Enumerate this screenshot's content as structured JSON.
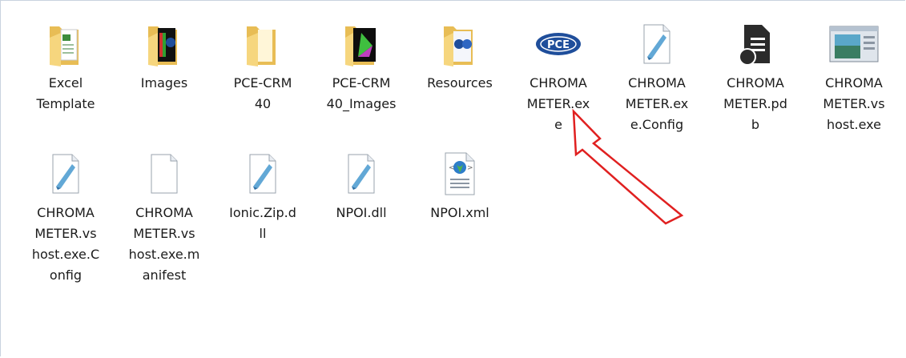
{
  "files": [
    {
      "name": "Excel Template",
      "lines": [
        "Excel",
        "Template"
      ],
      "icon": "folder-excel-icon",
      "interactable": true
    },
    {
      "name": "Images",
      "lines": [
        "Images"
      ],
      "icon": "folder-images-icon",
      "interactable": true
    },
    {
      "name": "PCE-CRM 40",
      "lines": [
        "PCE-CRM",
        "40"
      ],
      "icon": "folder-icon",
      "interactable": true
    },
    {
      "name": "PCE-CRM 40_Images",
      "lines": [
        "PCE-CRM",
        "40_Images"
      ],
      "icon": "folder-chromaticity-icon",
      "interactable": true
    },
    {
      "name": "Resources",
      "lines": [
        "Resources"
      ],
      "icon": "folder-resources-icon",
      "interactable": true
    },
    {
      "name": "CHROMA METER.exe",
      "lines": [
        "CHROMA",
        "METER.ex",
        "e"
      ],
      "icon": "pce-logo-icon",
      "interactable": true
    },
    {
      "name": "CHROMA METER.exe.Config",
      "lines": [
        "CHROMA",
        "METER.ex",
        "e.Config"
      ],
      "icon": "config-file-icon",
      "interactable": true
    },
    {
      "name": "CHROMA METER.pdb",
      "lines": [
        "CHROMA",
        "METER.pd",
        "b"
      ],
      "icon": "pdb-file-icon",
      "interactable": true
    },
    {
      "name": "CHROMA METER.vshost.exe",
      "lines": [
        "CHROMA",
        "METER.vs",
        "host.exe"
      ],
      "icon": "window-app-icon",
      "interactable": true
    },
    {
      "name": "CHROMA METER.vshost.exe.Config",
      "lines": [
        "CHROMA",
        "METER.vs",
        "host.exe.C",
        "onfig"
      ],
      "icon": "config-file-icon",
      "interactable": true
    },
    {
      "name": "CHROMA METER.vshost.exe.manifest",
      "lines": [
        "CHROMA",
        "METER.vs",
        "host.exe.m",
        "anifest"
      ],
      "icon": "blank-file-icon",
      "interactable": true
    },
    {
      "name": "Ionic.Zip.dll",
      "lines": [
        "Ionic.Zip.d",
        "ll"
      ],
      "icon": "config-file-icon",
      "interactable": true
    },
    {
      "name": "NPOI.dll",
      "lines": [
        "NPOI.dll"
      ],
      "icon": "config-file-icon",
      "interactable": true
    },
    {
      "name": "NPOI.xml",
      "lines": [
        "NPOI.xml"
      ],
      "icon": "xml-file-icon",
      "interactable": true
    }
  ],
  "colors": {
    "folder_front": "#f6d67e",
    "folder_back": "#e8bd55",
    "pce_blue": "#1f4e9b",
    "arrow_red": "#e02020"
  }
}
